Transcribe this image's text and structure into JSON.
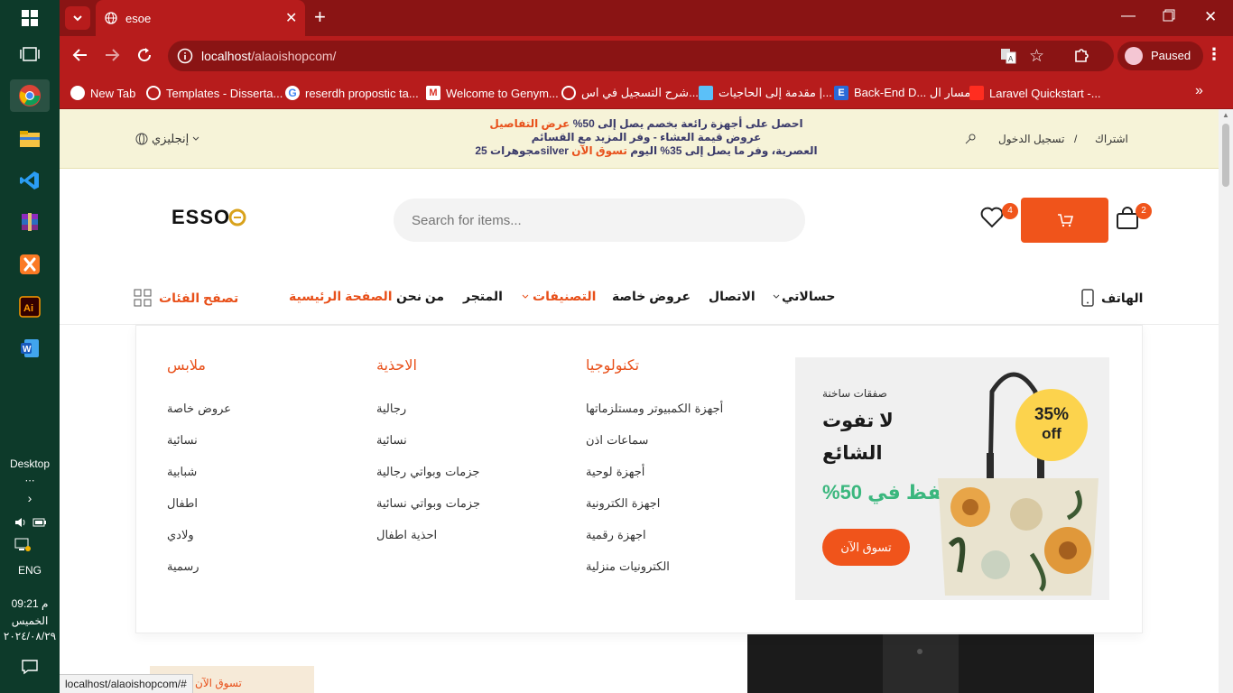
{
  "taskbar": {
    "desktop_label": "Desktop",
    "lang": "ENG",
    "time": "09:21 م",
    "day": "الخميس",
    "date": "٢٠٢٤/٠٨/٢٩"
  },
  "browser": {
    "tab_title": "esoe",
    "url_host": "localhost",
    "url_path": "/alaoishopcom/",
    "profile_status": "Paused",
    "bookmarks": [
      "New Tab",
      "Templates - Disserta...",
      "reserdh propostic ta...",
      "Welcome to Genym...",
      "شرح التسجيل في اس...",
      "مقدمة إلى الحاجيات |...",
      "Back-End D... مسار ال",
      "Laravel Quickstart -..."
    ],
    "status_url": "localhost/alaoishopcom/#"
  },
  "topbar": {
    "language": "إنجليزي",
    "promo_line1_a": "احصل على أجهزة رائعة بخصم يصل إلى 50%",
    "promo_line1_link": "عرض التفاصيل",
    "promo_line2": "عروض قيمة العشاء - وفر المزيد مع القسائم",
    "promo_line3_a": "العصرية، وفر ما يصل إلى 35% اليوم",
    "promo_line3_link": "تسوق الآن",
    "promo_line3_b": "silver",
    "promo_line3_c": "مجوهرات 25",
    "login": "تسجيل الدخول",
    "separator": "/",
    "register": "اشتراك"
  },
  "header": {
    "logo_text": "ESSO",
    "search_placeholder": "Search for items...",
    "wishlist_count": "4",
    "cart_count": "2"
  },
  "nav": {
    "browse_categories": "تصفح الفئات",
    "home": "الصفحة الرئيسية",
    "about": "من نحن",
    "shop": "المتجر",
    "categories": "التصنيفات",
    "special_offers": "عروض خاصة",
    "contact": "الاتصال",
    "my_account": "حسالاتي",
    "phone": "الهاتف"
  },
  "mega": {
    "columns": [
      {
        "title": "ملابس",
        "items": [
          "عروض خاصة",
          "نسائية",
          "شبابية",
          "اطفال",
          "ولادي",
          "رسمية"
        ]
      },
      {
        "title": "الاحذية",
        "items": [
          "رجالية",
          "نسائية",
          "جزمات وبواتي رجالية",
          "جزمات وبواتي نسائية",
          "احذية اطفال"
        ]
      },
      {
        "title": "تكنولوجيا",
        "items": [
          "أجهزة الكمبيوتر ومستلزماتها",
          "سماعات اذن",
          "أجهزة لوحية",
          "اجهزة الكترونية",
          "اجهزة رقمية",
          "الكترونيات منزلية"
        ]
      }
    ],
    "banner": {
      "eyebrow": "صفقات ساخنة",
      "title_line1": "لا تفوت",
      "title_line2": "الشائع",
      "save": "%حفظ في 50",
      "badge_top": "35%",
      "badge_bottom": "off",
      "cta": "تسوق الآن"
    }
  },
  "hero": {
    "cta_partial": "تسوق الآن"
  },
  "colors": {
    "accent": "#f0541b",
    "browser_red": "#b71c1c",
    "green": "#3bb77e",
    "promo_bg": "#f6f3d8"
  }
}
